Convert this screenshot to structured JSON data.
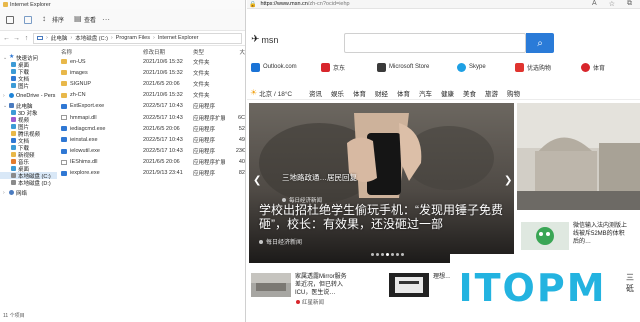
{
  "explorer": {
    "title": "Internet Explorer",
    "toolbar": {
      "sort_label": "排序",
      "view_label": "查看",
      "more_label": "···"
    },
    "breadcrumb": [
      "此电脑",
      "本地磁盘 (C:)",
      "Program Files",
      "Internet Explorer"
    ],
    "nav": [
      {
        "label": "快速访问",
        "icon": "star-icon",
        "type": "header"
      },
      {
        "label": "桌面",
        "icon": "desktop-icon",
        "type": "item"
      },
      {
        "label": "下载",
        "icon": "download-icon",
        "type": "item"
      },
      {
        "label": "文档",
        "icon": "document-icon",
        "type": "item"
      },
      {
        "label": "图片",
        "icon": "picture-icon",
        "type": "item"
      },
      {
        "label": "OneDrive - Pers",
        "icon": "cloud-icon",
        "type": "header"
      },
      {
        "label": "此电脑",
        "icon": "pc-icon",
        "type": "header"
      },
      {
        "label": "3D 对象",
        "icon": "3d-objects-icon",
        "type": "item"
      },
      {
        "label": "视频",
        "icon": "video-icon",
        "type": "item"
      },
      {
        "label": "图片",
        "icon": "picture-icon",
        "type": "item"
      },
      {
        "label": "腾讯视频",
        "icon": "folder-icon",
        "type": "item"
      },
      {
        "label": "文档",
        "icon": "document-icon",
        "type": "item"
      },
      {
        "label": "下载",
        "icon": "download-icon",
        "type": "item"
      },
      {
        "label": "新视频",
        "icon": "folder-icon",
        "type": "item"
      },
      {
        "label": "音乐",
        "icon": "music-icon",
        "type": "item"
      },
      {
        "label": "桌面",
        "icon": "desktop-icon",
        "type": "item"
      },
      {
        "label": "本地磁盘 (C:)",
        "icon": "drive-icon",
        "type": "item",
        "selected": true
      },
      {
        "label": "本地磁盘 (D:)",
        "icon": "drive-icon",
        "type": "item"
      },
      {
        "label": "网络",
        "icon": "network-icon",
        "type": "header"
      }
    ],
    "columns": {
      "name": "名称",
      "date": "修改日期",
      "type": "类型",
      "size": "大"
    },
    "files": [
      {
        "name": "en-US",
        "date": "2021/10/6 15:32",
        "type": "文件夹",
        "size": "",
        "kind": "folder"
      },
      {
        "name": "images",
        "date": "2021/10/6 15:32",
        "type": "文件夹",
        "size": "",
        "kind": "folder"
      },
      {
        "name": "SIGNUP",
        "date": "2021/6/5 20:06",
        "type": "文件夹",
        "size": "",
        "kind": "folder"
      },
      {
        "name": "zh-CN",
        "date": "2021/10/6 15:32",
        "type": "文件夹",
        "size": "",
        "kind": "folder"
      },
      {
        "name": "ExtExport.exe",
        "date": "2022/5/17 10:43",
        "type": "应用程序",
        "size": "",
        "kind": "exe"
      },
      {
        "name": "hmmapi.dll",
        "date": "2022/5/17 10:43",
        "type": "应用程序扩展",
        "size": "6C",
        "kind": "dll"
      },
      {
        "name": "iediagcmd.exe",
        "date": "2021/6/5 20:06",
        "type": "应用程序",
        "size": "52",
        "kind": "exe"
      },
      {
        "name": "ieinstal.exe",
        "date": "2022/5/17 10:43",
        "type": "应用程序",
        "size": "49",
        "kind": "exe"
      },
      {
        "name": "ielowutil.exe",
        "date": "2022/5/17 10:43",
        "type": "应用程序",
        "size": "23€",
        "kind": "exe"
      },
      {
        "name": "IEShims.dll",
        "date": "2021/6/5 20:06",
        "type": "应用程序扩展",
        "size": "40",
        "kind": "dll"
      },
      {
        "name": "iexplore.exe",
        "date": "2021/9/13 23:41",
        "type": "应用程序",
        "size": "82",
        "kind": "exe"
      }
    ],
    "status": "11 个项目"
  },
  "browser": {
    "url_host": "https://www.msn.cn",
    "url_rest": "/zh-cn?ocid=iehp",
    "logo_text": "msn",
    "quick_links": [
      {
        "label": "Outlook.com",
        "icon": "outlook-icon",
        "color": "#1a73d6"
      },
      {
        "label": "京东",
        "icon": "jd-icon",
        "color": "#d8262c"
      },
      {
        "label": "Microsoft Store",
        "icon": "store-icon",
        "color": "#3a3a3a"
      },
      {
        "label": "Skype",
        "icon": "skype-icon",
        "color": "#1ea0e4"
      },
      {
        "label": "优选购物",
        "icon": "shopping-icon",
        "color": "#e0342f"
      },
      {
        "label": "体育",
        "icon": "sports-icon",
        "color": "#d8262c"
      }
    ],
    "weather": "北京 / 18°C",
    "categories": [
      "资讯",
      "娱乐",
      "体育",
      "财经",
      "体育",
      "汽车",
      "健康",
      "美食",
      "旅游",
      "购物"
    ],
    "hero": {
      "caption": "学校出招杜绝学生偷玩手机：“发现用锤子免费砸”，校长：有效果，还没砸过一部",
      "source": "每日经济新闻"
    },
    "side": {
      "caption": "三地路政通…居民回复",
      "source": "每日经济新闻"
    },
    "news": [
      {
        "title": "家属透露Mirror服务差近况，但已转入ICU，医生说…",
        "source": "红星新闻"
      },
      {
        "title": "理想…",
        "source": ""
      },
      {
        "title": "微信输入法内测版上线被斥52MB的体积后的…",
        "source": ""
      }
    ],
    "watermark": "ITOPM",
    "right_fragment": "三砥"
  },
  "colors": {
    "accent": "#2a7bd8",
    "folder": "#e8b84a",
    "watermark": "#23b3e0"
  }
}
